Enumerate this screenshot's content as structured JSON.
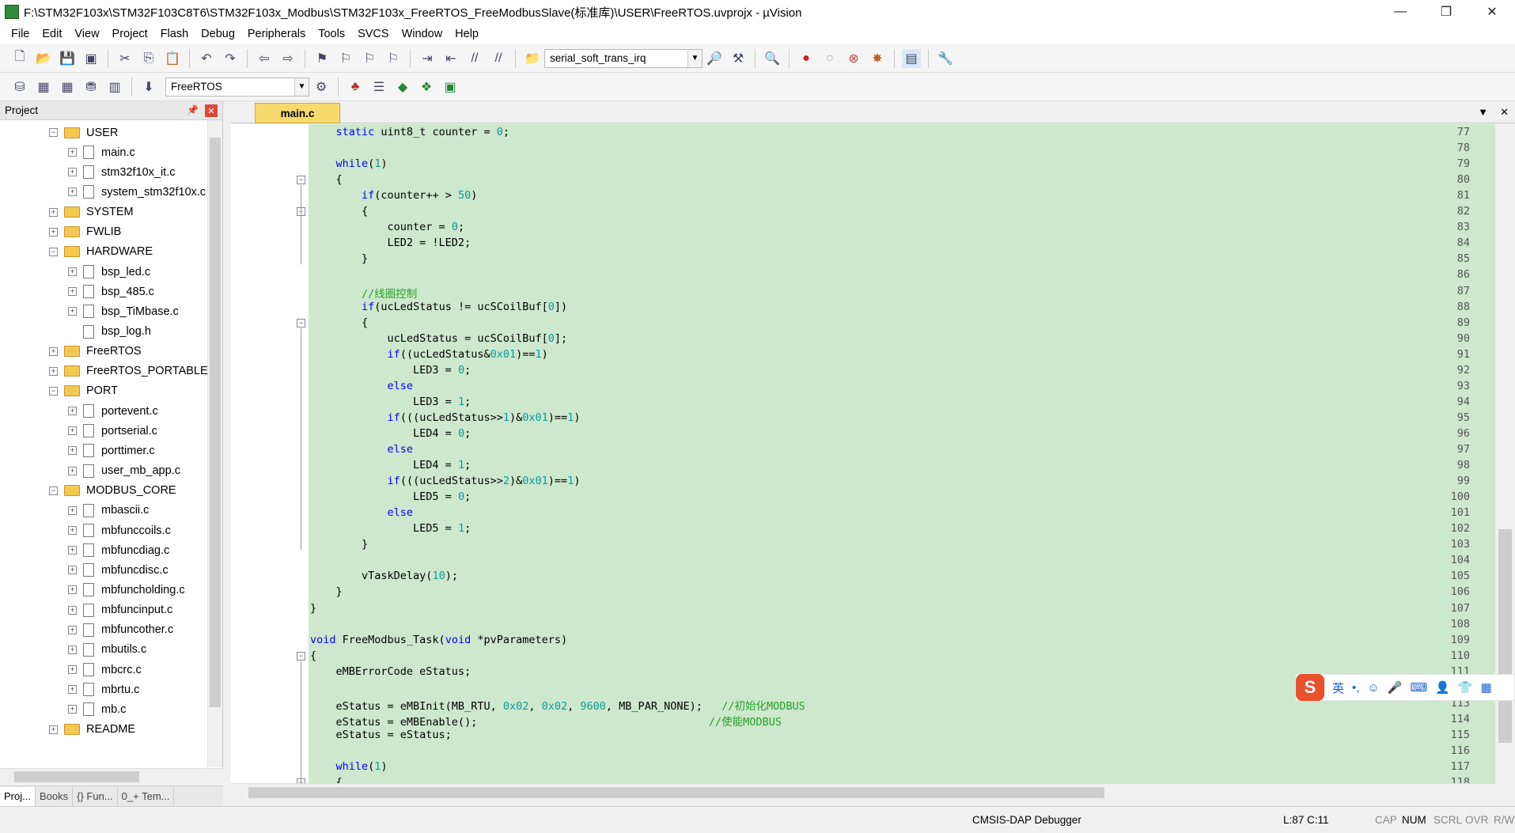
{
  "window": {
    "title": "F:\\STM32F103x\\STM32F103C8T6\\STM32F103x_Modbus\\STM32F103x_FreeRTOS_FreeModbusSlave(标准库)\\USER\\FreeRTOS.uvprojx - µVision",
    "minimize": "—",
    "maximize": "❐",
    "close": "✕"
  },
  "menu": [
    "File",
    "Edit",
    "View",
    "Project",
    "Flash",
    "Debug",
    "Peripherals",
    "Tools",
    "SVCS",
    "Window",
    "Help"
  ],
  "toolbar": {
    "search_combo": "serial_soft_trans_irq",
    "target_combo": "FreeRTOS"
  },
  "project_panel": {
    "title": "Project",
    "tree": [
      {
        "label": "USER",
        "type": "folder",
        "expand": "−"
      },
      {
        "label": "main.c",
        "type": "file",
        "expand": "+"
      },
      {
        "label": "stm32f10x_it.c",
        "type": "file",
        "expand": "+"
      },
      {
        "label": "system_stm32f10x.c",
        "type": "file",
        "expand": "+"
      },
      {
        "label": "SYSTEM",
        "type": "folder",
        "expand": "+"
      },
      {
        "label": "FWLIB",
        "type": "folder",
        "expand": "+"
      },
      {
        "label": "HARDWARE",
        "type": "folder",
        "expand": "−"
      },
      {
        "label": "bsp_led.c",
        "type": "file",
        "expand": "+"
      },
      {
        "label": "bsp_485.c",
        "type": "file",
        "expand": "+"
      },
      {
        "label": "bsp_TiMbase.c",
        "type": "file",
        "expand": "+"
      },
      {
        "label": "bsp_log.h",
        "type": "file",
        "expand": ""
      },
      {
        "label": "FreeRTOS",
        "type": "folder",
        "expand": "+"
      },
      {
        "label": "FreeRTOS_PORTABLE",
        "type": "folder",
        "expand": "+"
      },
      {
        "label": "PORT",
        "type": "folder",
        "expand": "−"
      },
      {
        "label": "portevent.c",
        "type": "file",
        "expand": "+"
      },
      {
        "label": "portserial.c",
        "type": "file",
        "expand": "+"
      },
      {
        "label": "porttimer.c",
        "type": "file",
        "expand": "+"
      },
      {
        "label": "user_mb_app.c",
        "type": "file",
        "expand": "+"
      },
      {
        "label": "MODBUS_CORE",
        "type": "folder",
        "expand": "−"
      },
      {
        "label": "mbascii.c",
        "type": "file",
        "expand": "+"
      },
      {
        "label": "mbfunccoils.c",
        "type": "file",
        "expand": "+"
      },
      {
        "label": "mbfuncdiag.c",
        "type": "file",
        "expand": "+"
      },
      {
        "label": "mbfuncdisc.c",
        "type": "file",
        "expand": "+"
      },
      {
        "label": "mbfuncholding.c",
        "type": "file",
        "expand": "+"
      },
      {
        "label": "mbfuncinput.c",
        "type": "file",
        "expand": "+"
      },
      {
        "label": "mbfuncother.c",
        "type": "file",
        "expand": "+"
      },
      {
        "label": "mbutils.c",
        "type": "file",
        "expand": "+"
      },
      {
        "label": "mbcrc.c",
        "type": "file",
        "expand": "+"
      },
      {
        "label": "mbrtu.c",
        "type": "file",
        "expand": "+"
      },
      {
        "label": "mb.c",
        "type": "file",
        "expand": "+"
      },
      {
        "label": "README",
        "type": "folder",
        "expand": "+"
      }
    ],
    "tabs": [
      "Proj...",
      "Books",
      "{} Fun...",
      "0_+ Tem..."
    ]
  },
  "editor": {
    "tab": "main.c",
    "lines": [
      {
        "n": "77",
        "fold": "",
        "html": "    <span class='kw'>static</span> uint8_t counter = <span class='num'>0</span>;"
      },
      {
        "n": "78",
        "fold": "",
        "html": ""
      },
      {
        "n": "79",
        "fold": "",
        "html": "    <span class='kw'>while</span>(<span class='num'>1</span>)"
      },
      {
        "n": "80",
        "fold": "−",
        "html": "    {"
      },
      {
        "n": "81",
        "fold": "",
        "html": "        <span class='kw'>if</span>(counter++ > <span class='num'>50</span>)"
      },
      {
        "n": "82",
        "fold": "−",
        "html": "        {"
      },
      {
        "n": "83",
        "fold": "",
        "html": "            counter = <span class='num'>0</span>;"
      },
      {
        "n": "84",
        "fold": "",
        "html": "            LED2 = !LED2;"
      },
      {
        "n": "85",
        "fold": "",
        "html": "        }"
      },
      {
        "n": "86",
        "fold": "",
        "html": ""
      },
      {
        "n": "87",
        "fold": "",
        "html": "        <span class='cmt'>//线圈控制</span>"
      },
      {
        "n": "88",
        "fold": "",
        "html": "        <span class='kw'>if</span>(ucLedStatus != ucSCoilBuf[<span class='num'>0</span>])"
      },
      {
        "n": "89",
        "fold": "−",
        "html": "        {"
      },
      {
        "n": "90",
        "fold": "",
        "html": "            ucLedStatus = ucSCoilBuf[<span class='num'>0</span>];"
      },
      {
        "n": "91",
        "fold": "",
        "html": "            <span class='kw'>if</span>((ucLedStatus&amp;<span class='num'>0x01</span>)==<span class='num'>1</span>)"
      },
      {
        "n": "92",
        "fold": "",
        "html": "                LED3 = <span class='num'>0</span>;"
      },
      {
        "n": "93",
        "fold": "",
        "html": "            <span class='kw'>else</span>"
      },
      {
        "n": "94",
        "fold": "",
        "html": "                LED3 = <span class='num'>1</span>;"
      },
      {
        "n": "95",
        "fold": "",
        "html": "            <span class='kw'>if</span>(((ucLedStatus>><span class='num'>1</span>)&amp;<span class='num'>0x01</span>)==<span class='num'>1</span>)"
      },
      {
        "n": "96",
        "fold": "",
        "html": "                LED4 = <span class='num'>0</span>;"
      },
      {
        "n": "97",
        "fold": "",
        "html": "            <span class='kw'>else</span>"
      },
      {
        "n": "98",
        "fold": "",
        "html": "                LED4 = <span class='num'>1</span>;"
      },
      {
        "n": "99",
        "fold": "",
        "html": "            <span class='kw'>if</span>(((ucLedStatus>><span class='num'>2</span>)&amp;<span class='num'>0x01</span>)==<span class='num'>1</span>)"
      },
      {
        "n": "100",
        "fold": "",
        "html": "                LED5 = <span class='num'>0</span>;"
      },
      {
        "n": "101",
        "fold": "",
        "html": "            <span class='kw'>else</span>"
      },
      {
        "n": "102",
        "fold": "",
        "html": "                LED5 = <span class='num'>1</span>;"
      },
      {
        "n": "103",
        "fold": "",
        "html": "        }"
      },
      {
        "n": "104",
        "fold": "",
        "html": ""
      },
      {
        "n": "105",
        "fold": "",
        "html": "        vTaskDelay(<span class='num'>10</span>);"
      },
      {
        "n": "106",
        "fold": "",
        "html": "    }"
      },
      {
        "n": "107",
        "fold": "",
        "html": "}"
      },
      {
        "n": "108",
        "fold": "",
        "html": ""
      },
      {
        "n": "109",
        "fold": "",
        "html": "<span class='kw'>void</span> FreeModbus_Task(<span class='kw'>void</span> *pvParameters)"
      },
      {
        "n": "110",
        "fold": "−",
        "html": "{"
      },
      {
        "n": "111",
        "fold": "",
        "html": "    eMBErrorCode eStatus;"
      },
      {
        "n": "112",
        "fold": "",
        "html": ""
      },
      {
        "n": "113",
        "fold": "",
        "html": "    eStatus = eMBInit(MB_RTU, <span class='num'>0x02</span>, <span class='num'>0x02</span>, <span class='num'>9600</span>, MB_PAR_NONE);   <span class='cmt'>//初始化MODBUS</span>"
      },
      {
        "n": "114",
        "fold": "",
        "html": "    eStatus = eMBEnable();                                    <span class='cmt'>//使能MODBUS</span>"
      },
      {
        "n": "115",
        "fold": "",
        "html": "    eStatus = eStatus;"
      },
      {
        "n": "116",
        "fold": "",
        "html": ""
      },
      {
        "n": "117",
        "fold": "",
        "html": "    <span class='kw'>while</span>(<span class='num'>1</span>)"
      },
      {
        "n": "118",
        "fold": "−",
        "html": "    {"
      }
    ]
  },
  "status": {
    "debugger": "CMSIS-DAP Debugger",
    "position": "L:87 C:11",
    "cap": "CAP",
    "num": "NUM",
    "scrl": "SCRL",
    "ovr": "OVR",
    "rw": "R/W"
  },
  "ime": {
    "logo": "S",
    "lang": "英",
    "punct": "•,"
  }
}
